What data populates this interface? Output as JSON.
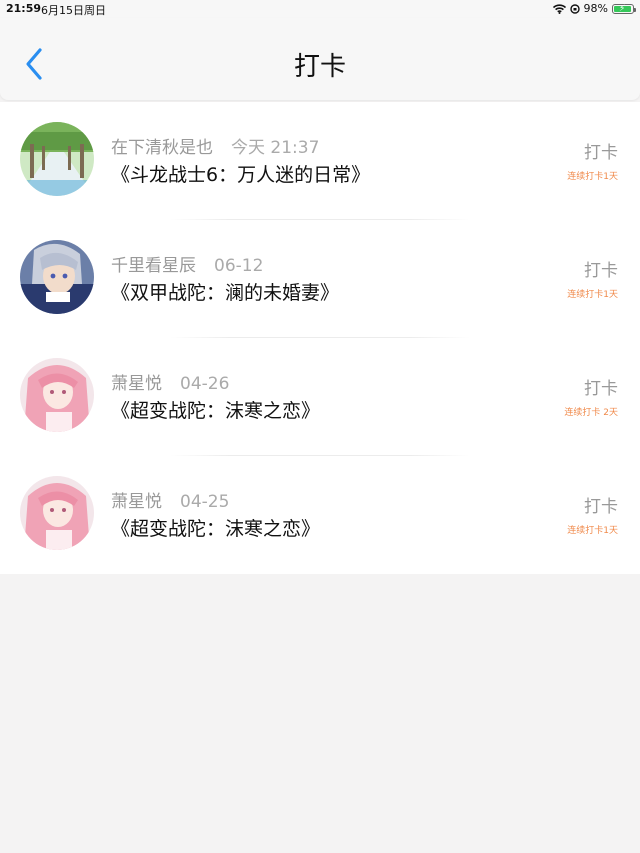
{
  "status_bar": {
    "time": "21:59",
    "date": "6月15日周日",
    "battery": "98%",
    "battery_color": "#35c759"
  },
  "header": {
    "title": "打卡",
    "back_icon": "chevron-left-icon",
    "accent": "#2a8ef0"
  },
  "items": [
    {
      "name": "在下清秋是也",
      "date": "今天 21:37",
      "title": "《斗龙战士6：万人迷的日常》",
      "action": "打卡",
      "streak": "连续打卡1天"
    },
    {
      "name": "千里看星辰",
      "date": "06-12",
      "title": "《双甲战陀：澜的未婚妻》",
      "action": "打卡",
      "streak": "连续打卡1天"
    },
    {
      "name": "萧星悦",
      "date": "04-26",
      "title": "《超变战陀：沫寒之恋》",
      "action": "打卡",
      "streak": "连续打卡 2天"
    },
    {
      "name": "萧星悦",
      "date": "04-25",
      "title": "《超变战陀：沫寒之恋》",
      "action": "打卡",
      "streak": "连续打卡1天"
    }
  ],
  "colors": {
    "streak": "#f08a4b",
    "background": "#f4f3f3"
  }
}
